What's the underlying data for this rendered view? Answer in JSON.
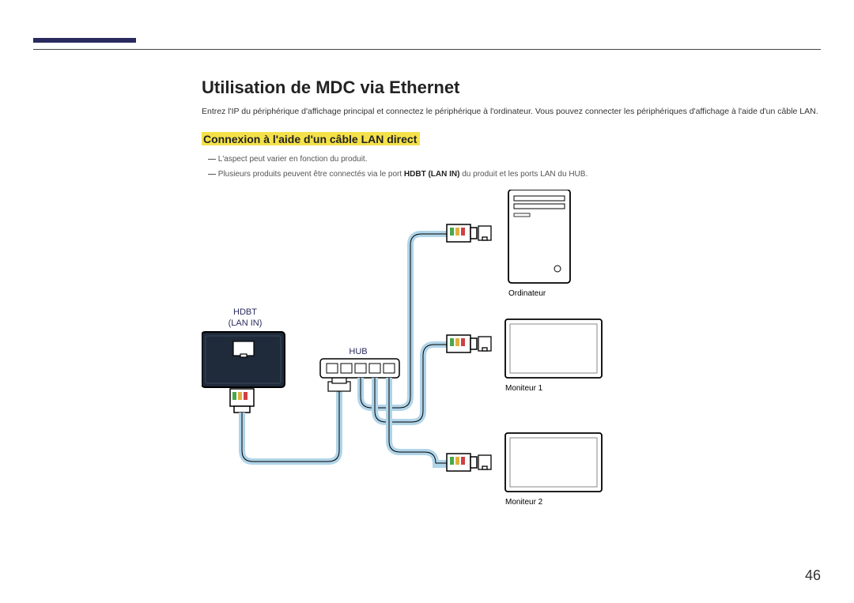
{
  "page": {
    "number": "46"
  },
  "heading": "Utilisation de MDC via Ethernet",
  "intro": "Entrez l'IP du périphérique d'affichage principal et connectez le périphérique à l'ordinateur. Vous pouvez connecter les périphériques d'affichage à l'aide d'un câble LAN.",
  "subheading": "Connexion à l'aide d'un câble LAN direct",
  "notes": {
    "n1": "L'aspect peut varier en fonction du produit.",
    "n2_pre": "Plusieurs produits peuvent être connectés via le port ",
    "n2_bold": "HDBT (LAN IN)",
    "n2_post": " du produit et les ports LAN du HUB."
  },
  "diagram": {
    "hdbt_line1": "HDBT",
    "hdbt_line2": "(LAN IN)",
    "hub": "HUB",
    "computer": "Ordinateur",
    "monitor1": "Moniteur 1",
    "monitor2": "Moniteur 2"
  }
}
